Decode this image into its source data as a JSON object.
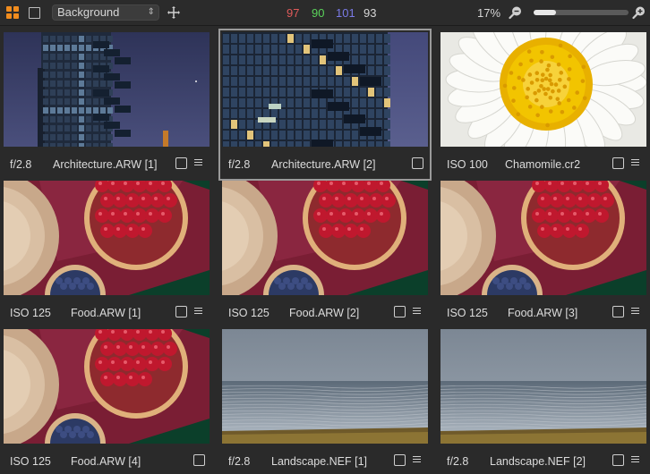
{
  "toolbar": {
    "background_select": "Background",
    "counts": [
      {
        "value": "97",
        "color": "#e05a5a"
      },
      {
        "value": "90",
        "color": "#5ad25a"
      },
      {
        "value": "101",
        "color": "#7a7ae6"
      },
      {
        "value": "93",
        "color": "#d6d6d6"
      }
    ],
    "zoom_percent": "17%",
    "zoom_level": 0.24
  },
  "thumbnails": [
    {
      "meta": "f/2.8",
      "name": "Architecture.ARW [1]",
      "image": "architecture-far",
      "selected": false,
      "list_icon": true
    },
    {
      "meta": "f/2.8",
      "name": "Architecture.ARW [2]",
      "image": "architecture-near",
      "selected": true,
      "list_icon": false
    },
    {
      "meta": "ISO 100",
      "name": "Chamomile.cr2",
      "image": "chamomile",
      "selected": false,
      "list_icon": true
    },
    {
      "meta": "ISO 125",
      "name": "Food.ARW [1]",
      "image": "food",
      "selected": false,
      "list_icon": true
    },
    {
      "meta": "ISO 125",
      "name": "Food.ARW [2]",
      "image": "food",
      "selected": false,
      "list_icon": true
    },
    {
      "meta": "ISO 125",
      "name": "Food.ARW [3]",
      "image": "food",
      "selected": false,
      "list_icon": true
    },
    {
      "meta": "ISO 125",
      "name": "Food.ARW [4]",
      "image": "food",
      "selected": false,
      "list_icon": false
    },
    {
      "meta": "f/2.8",
      "name": "Landscape.NEF [1]",
      "image": "landscape",
      "selected": false,
      "list_icon": true
    },
    {
      "meta": "f/2.8",
      "name": "Landscape.NEF [2]",
      "image": "landscape",
      "selected": false,
      "list_icon": true
    }
  ]
}
